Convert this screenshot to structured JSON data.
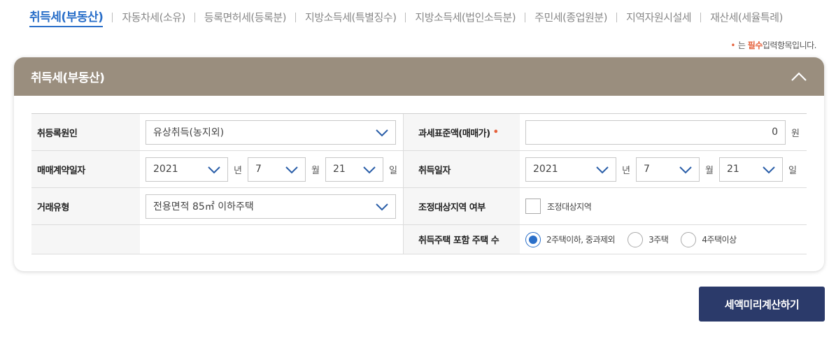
{
  "tabs": [
    {
      "label": "취득세(부동산)",
      "active": true
    },
    {
      "label": "자동차세(소유)"
    },
    {
      "label": "등록면허세(등록분)"
    },
    {
      "label": "지방소득세(특별징수)"
    },
    {
      "label": "지방소득세(법인소득분)"
    },
    {
      "label": "주민세(종업원분)"
    },
    {
      "label": "지역자원시설세"
    },
    {
      "label": "재산세(세율특례)"
    }
  ],
  "required_note": {
    "dot": "•",
    "prefix": "는",
    "strong": "필수",
    "suffix": "입력항목입니다."
  },
  "panel": {
    "title": "취득세(부동산)"
  },
  "form": {
    "acq_cause": {
      "label": "취등록원인",
      "value": "유상취득(농지외)"
    },
    "tax_base": {
      "label": "과세표준액(매매가)",
      "required_mark": "•",
      "value": "0",
      "unit": "원"
    },
    "contract_date": {
      "label": "매매계약일자",
      "year": "2021",
      "year_unit": "년",
      "month": "7",
      "month_unit": "월",
      "day": "21",
      "day_unit": "일"
    },
    "acq_date": {
      "label": "취득일자",
      "year": "2021",
      "year_unit": "년",
      "month": "7",
      "month_unit": "월",
      "day": "21",
      "day_unit": "일"
    },
    "deal_type": {
      "label": "거래유형",
      "value": "전용면적 85㎡ 이하주택"
    },
    "adjust_area": {
      "label": "조정대상지역 여부",
      "checkbox_label": "조정대상지역",
      "checked": false
    },
    "house_count": {
      "label": "취득주택 포함 주택 수",
      "options": [
        {
          "label": "2주택이하, 중과제외",
          "selected": true
        },
        {
          "label": "3주택",
          "selected": false
        },
        {
          "label": "4주택이상",
          "selected": false
        }
      ]
    }
  },
  "button": {
    "label": "세액미리계산하기"
  },
  "colors": {
    "accent": "#2a6fc9",
    "header": "#9a8e7e",
    "button": "#2b3a6a",
    "required": "#e5603a"
  }
}
